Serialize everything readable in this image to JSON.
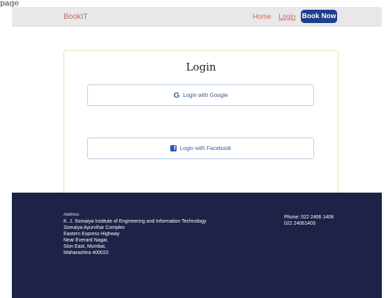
{
  "top_fragment": "page",
  "navbar": {
    "brand": "BookIT",
    "home": "Home",
    "login": "Login",
    "book_now": "Book Now"
  },
  "login": {
    "title": "Login",
    "google_label": "Login with Google",
    "facebook_label": "Login with Facebook"
  },
  "footer": {
    "address_heading": "Address:",
    "address_lines": [
      "K. J. Somaiya Institute of Engineering and Information Technology",
      "Somaiya Ayurvihar Complex",
      "Eastern Express Highway",
      "Near Everard Nagar,",
      "Sion East, Mumbai,",
      "Maharashtra 400022"
    ],
    "phone_line1": "Phone: 022 2406 1408",
    "phone_line2": "022 24061403"
  }
}
